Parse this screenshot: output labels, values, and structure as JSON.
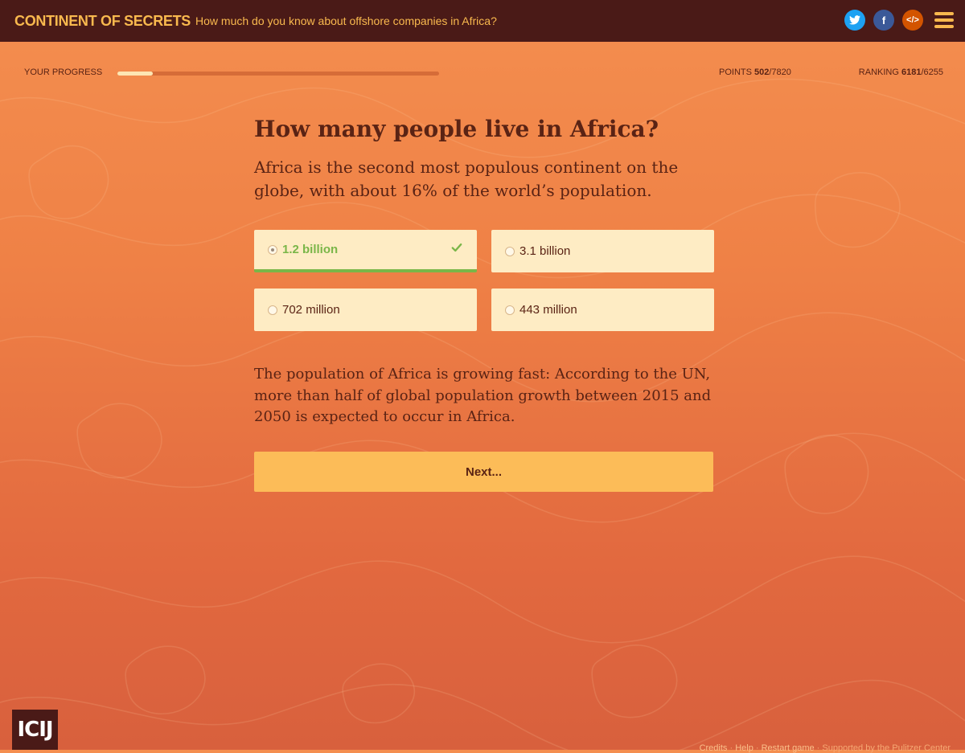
{
  "header": {
    "brand": "CONTINENT OF SECRETS",
    "tagline": "How much do you know about offshore companies in Africa?",
    "social": [
      {
        "name": "twitter",
        "glyph": "t"
      },
      {
        "name": "facebook",
        "glyph": "f"
      },
      {
        "name": "embed",
        "glyph": "</>"
      }
    ]
  },
  "stats": {
    "progress_label": "YOUR PROGRESS",
    "progress_fraction": 0.11,
    "points_label": "POINTS",
    "points_value": "502",
    "points_total": "/7820",
    "ranking_label": "RANKING",
    "ranking_value": "6181",
    "ranking_total": "/6255"
  },
  "question": {
    "title": "How many people live in Africa?",
    "description": "Africa is the second most populous continent on the globe, with about 16% of the world’s population.",
    "answers": [
      {
        "label": "1.2 billion",
        "correct": true
      },
      {
        "label": "3.1 billion",
        "correct": false
      },
      {
        "label": "702 million",
        "correct": false
      },
      {
        "label": "443 million",
        "correct": false
      }
    ],
    "explanation": "The population of Africa is growing fast: According to the UN, more than half of global population growth between 2015 and 2050 is expected to occur in Africa.",
    "next_label": "Next..."
  },
  "logo": "ICIJ",
  "footer": {
    "credits": "Credits",
    "help": "Help",
    "restart": "Restart game",
    "support": "Supported by the Pulitzer Center",
    "sep": " · "
  },
  "colors": {
    "header_bg": "#4a1a17",
    "accent": "#f9b94e",
    "correct": "#7ab648",
    "answer_bg": "#feecc4",
    "button_bg": "#fcbc58"
  }
}
